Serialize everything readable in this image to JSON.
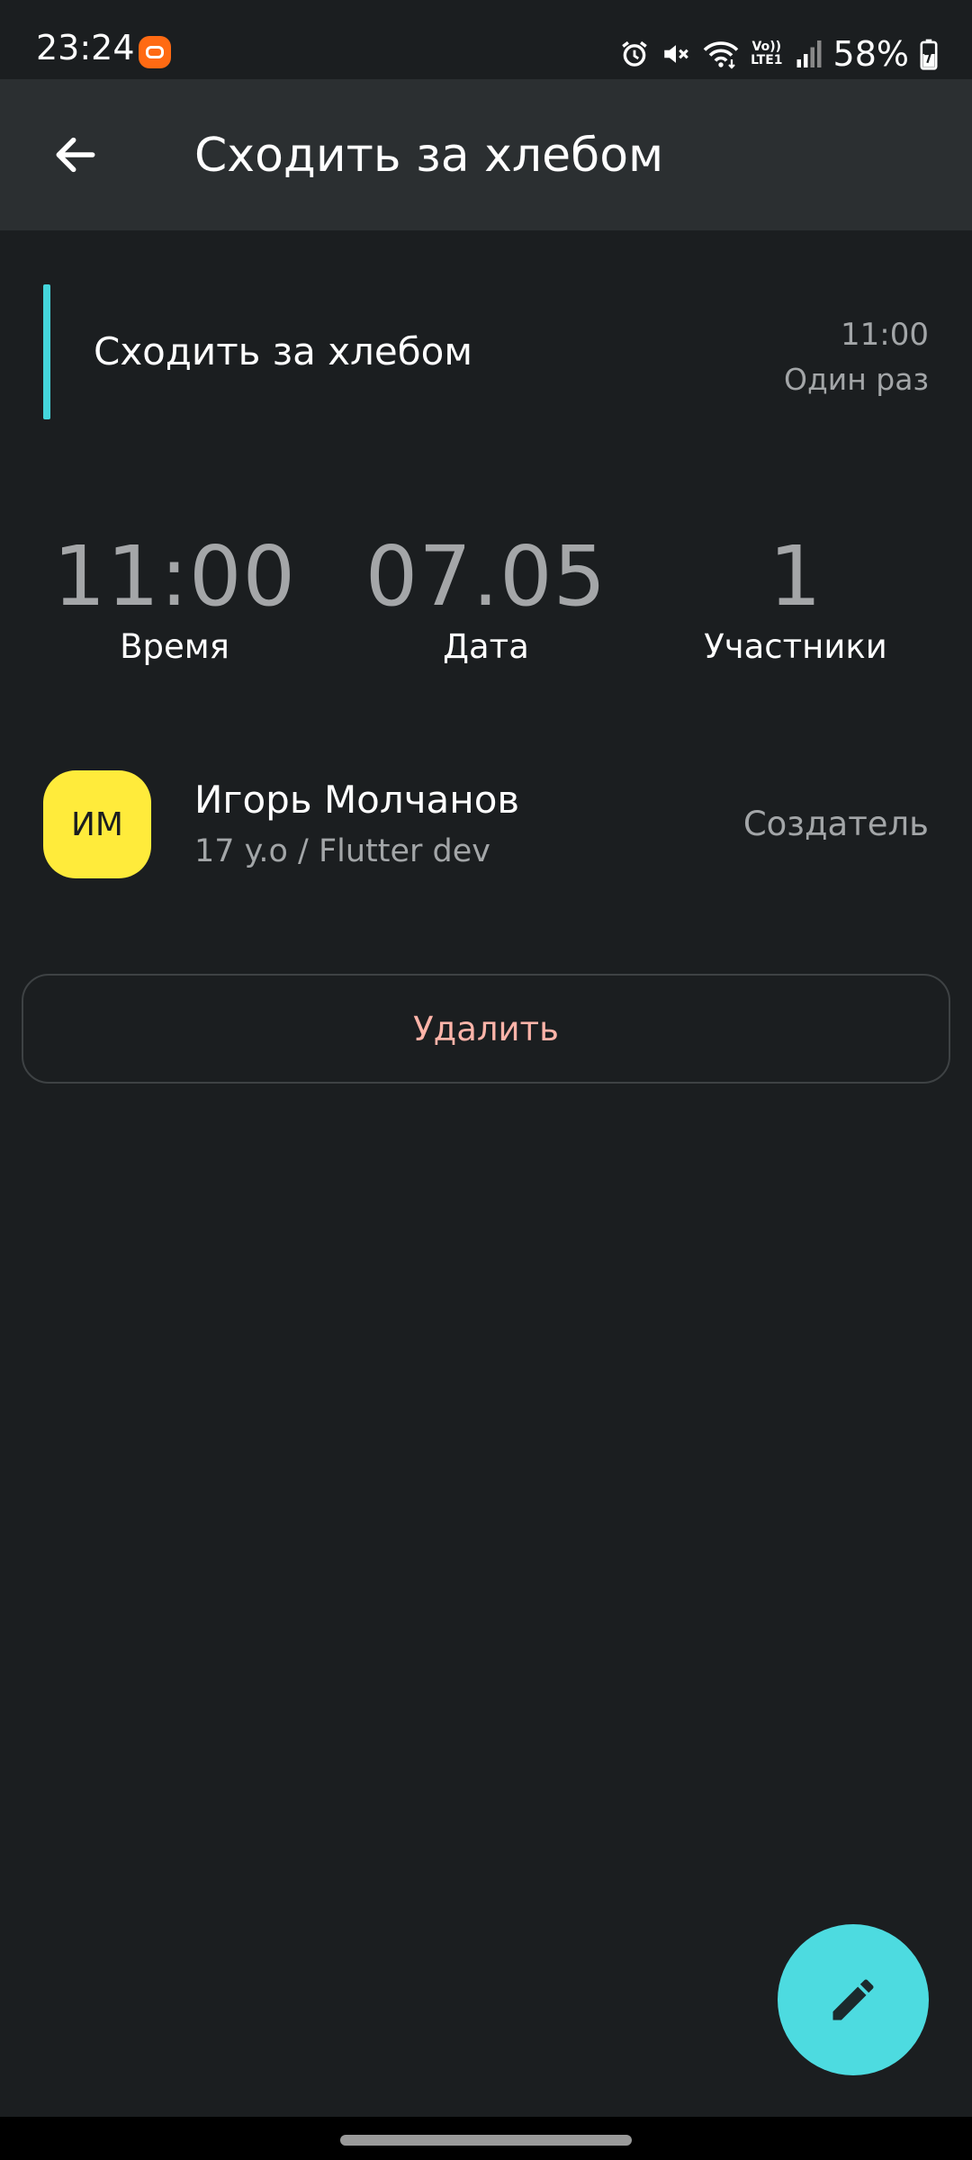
{
  "status_bar": {
    "time": "23:24",
    "network_top": "Vo))",
    "network_bottom": "LTE1",
    "battery": "58%"
  },
  "app_bar": {
    "title": "Сходить за хлебом"
  },
  "task": {
    "title": "Сходить за хлебом",
    "time": "11:00",
    "repeat": "Один раз",
    "accent_color": "#44d6dc"
  },
  "stats": [
    {
      "value": "11:00",
      "label": "Время"
    },
    {
      "value": "07.05",
      "label": "Дата"
    },
    {
      "value": "1",
      "label": "Участники"
    }
  ],
  "participant": {
    "initials": "ИМ",
    "name": "Игорь Молчанов",
    "info": "17 y.o / Flutter dev",
    "role": "Создатель",
    "avatar_color": "#ffeb3b"
  },
  "actions": {
    "delete_label": "Удалить"
  },
  "fab": {
    "icon": "pencil-icon",
    "color": "#4ddbe0"
  }
}
